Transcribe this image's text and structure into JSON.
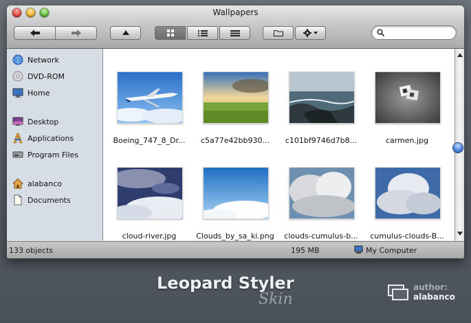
{
  "window": {
    "title": "Wallpapers"
  },
  "toolbar": {
    "back_icon": "arrow-left-icon",
    "forward_icon": "arrow-right-icon",
    "eject_icon": "eject-icon",
    "views": [
      "icon-view",
      "list-view",
      "column-view"
    ],
    "selected_view": "icon-view",
    "new_folder_icon": "folder-icon",
    "action_icon": "gear-icon",
    "search_placeholder": ""
  },
  "sidebar": {
    "devices": [
      {
        "label": "Network",
        "icon": "globe-icon"
      },
      {
        "label": "DVD-ROM",
        "icon": "disc-icon"
      },
      {
        "label": "Home",
        "icon": "monitor-icon"
      }
    ],
    "places": [
      {
        "label": "Desktop",
        "icon": "desktop-icon"
      },
      {
        "label": "Applications",
        "icon": "applications-icon"
      },
      {
        "label": "Program Files",
        "icon": "drive-icon"
      }
    ],
    "user": [
      {
        "label": "alabanco",
        "icon": "home-icon"
      },
      {
        "label": "Documents",
        "icon": "document-icon"
      }
    ]
  },
  "files": [
    {
      "name": "Boeing_747_8_Dr...",
      "thumb": "airplane-photo"
    },
    {
      "name": "c5a77e42bb930...",
      "thumb": "meadow-photo"
    },
    {
      "name": "c101bf9746d7b8...",
      "thumb": "seascape-photo"
    },
    {
      "name": "carmen.jpg",
      "thumb": "photo-collage"
    },
    {
      "name": "cloud-river.jpg",
      "thumb": "clouds-photo"
    },
    {
      "name": "Clouds_by_sa_ki.png",
      "thumb": "sky-photo"
    },
    {
      "name": "clouds-cumulus-b...",
      "thumb": "cumulus-photo"
    },
    {
      "name": "cumulus-clouds-B...",
      "thumb": "cumulus-photo"
    }
  ],
  "status": {
    "count": "133 objects",
    "size": "195 MB",
    "location": "My Computer",
    "location_icon": "computer-icon"
  },
  "branding": {
    "title": "Leopard Styler",
    "subtitle": "Skin",
    "author_label": "author:",
    "author_name": "alabanco"
  },
  "colors": {
    "sidebar_bg": "#d6dde5",
    "accent_blue": "#4b86d8"
  }
}
